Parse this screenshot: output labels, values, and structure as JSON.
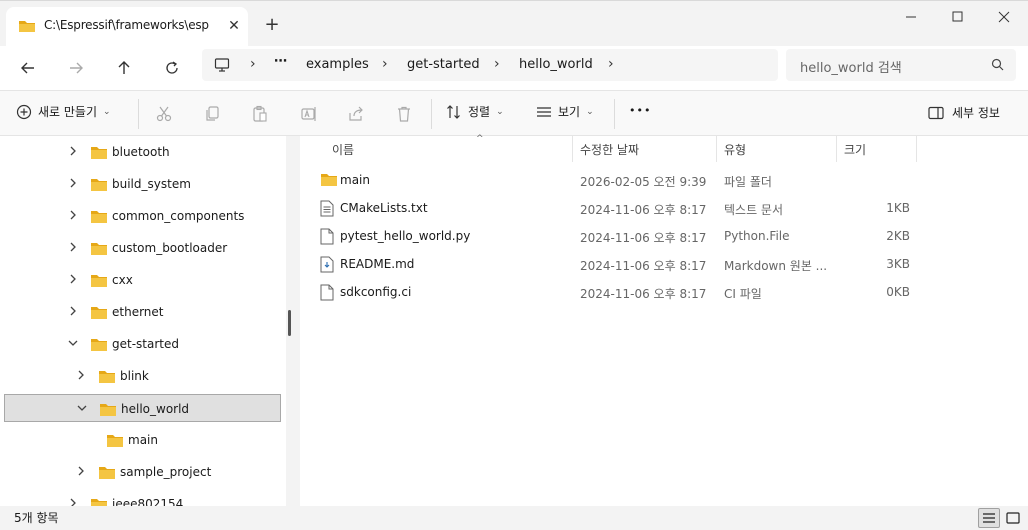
{
  "window": {
    "tab_title": "C:\\Espressif\\frameworks\\esp",
    "new_tab_symbol": "+",
    "close_symbol": "✕"
  },
  "address": {
    "ellipsis": "⋯",
    "crumbs": [
      "examples",
      "get-started",
      "hello_world"
    ],
    "search_placeholder": "hello_world 검색"
  },
  "toolbar": {
    "new_label": "새로 만들기",
    "sort_label": "정렬",
    "view_label": "보기",
    "more_label": "•••",
    "details_label": "세부 정보"
  },
  "sidebar": {
    "items": [
      {
        "label": "bluetooth",
        "level": 0,
        "expanded": false
      },
      {
        "label": "build_system",
        "level": 0,
        "expanded": false
      },
      {
        "label": "common_components",
        "level": 0,
        "expanded": false
      },
      {
        "label": "custom_bootloader",
        "level": 0,
        "expanded": false
      },
      {
        "label": "cxx",
        "level": 0,
        "expanded": false
      },
      {
        "label": "ethernet",
        "level": 0,
        "expanded": false
      },
      {
        "label": "get-started",
        "level": 0,
        "expanded": true
      },
      {
        "label": "blink",
        "level": 1,
        "expanded": false
      },
      {
        "label": "hello_world",
        "level": 1,
        "expanded": true,
        "selected": true
      },
      {
        "label": "main",
        "level": 2,
        "expanded": null
      },
      {
        "label": "sample_project",
        "level": 1,
        "expanded": false
      },
      {
        "label": "ieee802154",
        "level": 0,
        "expanded": false
      }
    ]
  },
  "list": {
    "columns": {
      "name": "이름",
      "date": "수정한 날짜",
      "type": "유형",
      "size": "크기"
    },
    "files": [
      {
        "name": "main",
        "date": "2026-02-05 오전 9:39",
        "type": "파일 폴더",
        "size": "",
        "icon": "folder-icon"
      },
      {
        "name": "CMakeLists.txt",
        "date": "2024-11-06 오후 8:17",
        "type": "텍스트 문서",
        "size": "1KB",
        "icon": "text-file-icon"
      },
      {
        "name": "pytest_hello_world.py",
        "date": "2024-11-06 오후 8:17",
        "type": "Python.File",
        "size": "2KB",
        "icon": "file-icon"
      },
      {
        "name": "README.md",
        "date": "2024-11-06 오후 8:17",
        "type": "Markdown 원본 ...",
        "size": "3KB",
        "icon": "markdown-file-icon"
      },
      {
        "name": "sdkconfig.ci",
        "date": "2024-11-06 오후 8:17",
        "type": "CI 파일",
        "size": "0KB",
        "icon": "file-icon"
      }
    ]
  },
  "status": {
    "count": "5개 항목"
  },
  "colors": {
    "folder": "#f4c542",
    "folder_dark": "#e6a817",
    "selection": "#e0e0e0"
  }
}
